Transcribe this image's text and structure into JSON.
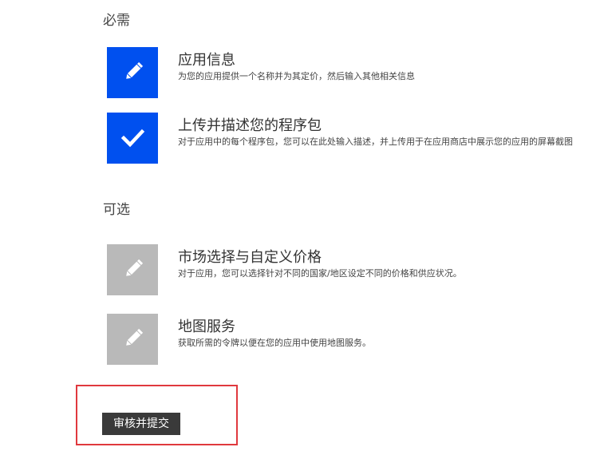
{
  "sections": {
    "required_label": "必需",
    "optional_label": "可选"
  },
  "steps": [
    {
      "title": "应用信息",
      "description": "为您的应用提供一个名称并为其定价，然后输入其他相关信息",
      "icon": "pencil-icon",
      "state": "active"
    },
    {
      "title": "上传并描述您的程序包",
      "description": "对于应用中的每个程序包，您可以在此处输入描述，并上传用于在应用商店中展示您的应用的屏幕截图",
      "icon": "checkmark-icon",
      "state": "complete"
    },
    {
      "title": "市场选择与自定义价格",
      "description": "对于应用，您可以选择针对不同的国家/地区设定不同的价格和供应状况。",
      "icon": "pencil-icon",
      "state": "disabled"
    },
    {
      "title": "地图服务",
      "description": "获取所需的令牌以便在您的应用中使用地图服务。",
      "icon": "pencil-icon",
      "state": "disabled"
    }
  ],
  "submit": {
    "label": "审核并提交"
  },
  "colors": {
    "tile_active": "#0050ef",
    "tile_disabled": "#b9b9b9",
    "button_bg": "#3a3a3a",
    "highlight_border": "#e0393e"
  }
}
